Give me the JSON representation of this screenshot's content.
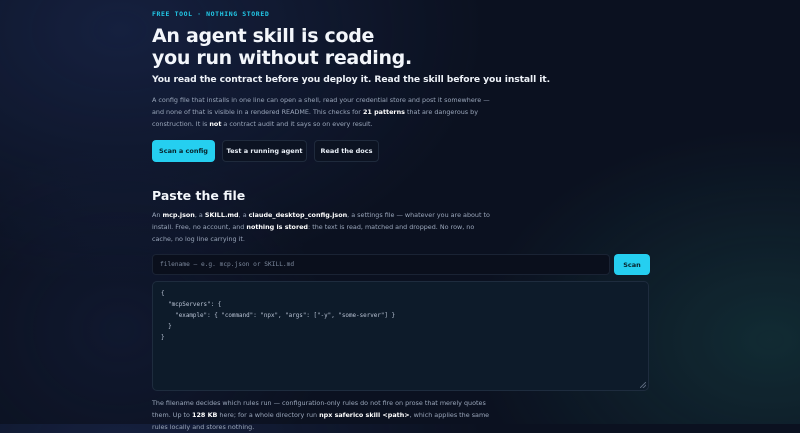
{
  "hero": {
    "eyebrow": "FREE TOOL · NOTHING STORED",
    "title_line1": "An agent skill is code",
    "title_line2": "you run without reading.",
    "lead": "You read the contract before you deploy it. Read the skill before you install it.",
    "intro": {
      "t1": "A config file that installs in one line can open a shell, read your credential store and post it somewhere — and none of that is visible in a rendered README. This checks for ",
      "b1": "21 patterns",
      "t2": " that are dangerous by construction. It is ",
      "b2": "not",
      "t3": " a contract audit and it says so on every result."
    }
  },
  "actions": {
    "scan_config": "Scan a config",
    "test_agent": "Test a running agent",
    "read_docs": "Read the docs"
  },
  "paste": {
    "heading": "Paste the file",
    "desc": {
      "t1": "An ",
      "b1": "mcp.json",
      "t2": ", a ",
      "b2": "SKILL.md",
      "t3": ", a ",
      "b3": "claude_desktop_config.json",
      "t4": ", a settings file — whatever you are about to install. Free, no account, and ",
      "b4": "nothing is stored",
      "t5": ": the text is read, matched and dropped. No row, no cache, no log line carrying it."
    },
    "filename_placeholder": "filename — e.g. mcp.json or SKILL.md",
    "scan_button": "Scan",
    "editor_value": "{\n  \"mcpServers\": {\n    \"example\": { \"command\": \"npx\", \"args\": [\"-y\", \"some-server\"] }\n  }\n}",
    "note": {
      "t1": "The filename decides which rules run — configuration-only rules do not fire on prose that merely quotes them. Up to ",
      "b1": "128 KB",
      "t2": " here; for a whole directory run ",
      "b2": "npx saferico skill <path>",
      "t3": ", which applies the same rules locally and stores nothing."
    }
  },
  "colors": {
    "accent": "#25cff0",
    "background": "#0b1120",
    "eyebrow": "#22c9e8"
  }
}
